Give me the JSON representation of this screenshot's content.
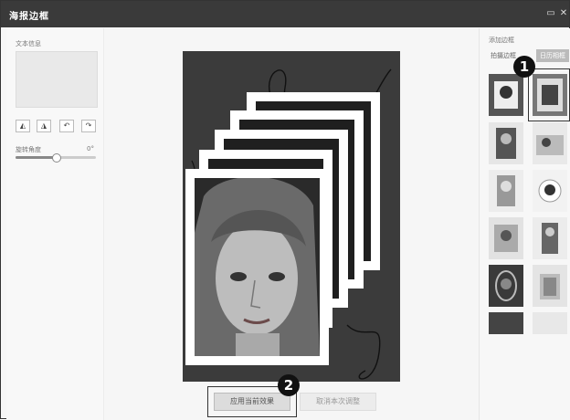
{
  "window": {
    "title": "海报边框",
    "controls": [
      "▭",
      "✕"
    ]
  },
  "left_panel": {
    "text_label": "文本信息",
    "rotate_label": "旋转角度",
    "rotate_value": "0°",
    "rotate_fraction": 0.5,
    "tool_icons": [
      "flip-horizontal-icon",
      "flip-vertical-icon",
      "rotate-left-icon",
      "rotate-right-icon"
    ],
    "tool_glyphs": [
      "◭",
      "◮",
      "↶",
      "↷"
    ]
  },
  "canvas": {
    "apply_button": "应用当前效果",
    "cancel_button": "取消本次调整"
  },
  "right_panel": {
    "header": "添加边框",
    "tabs": [
      "拍摄边框",
      "日历相框"
    ]
  },
  "badges": [
    "1",
    "2"
  ],
  "colors": {
    "title_bar": "#3a3a3a",
    "poster_bg": "#3b3b3b",
    "frame": "#ffffff",
    "badge": "#111111"
  }
}
